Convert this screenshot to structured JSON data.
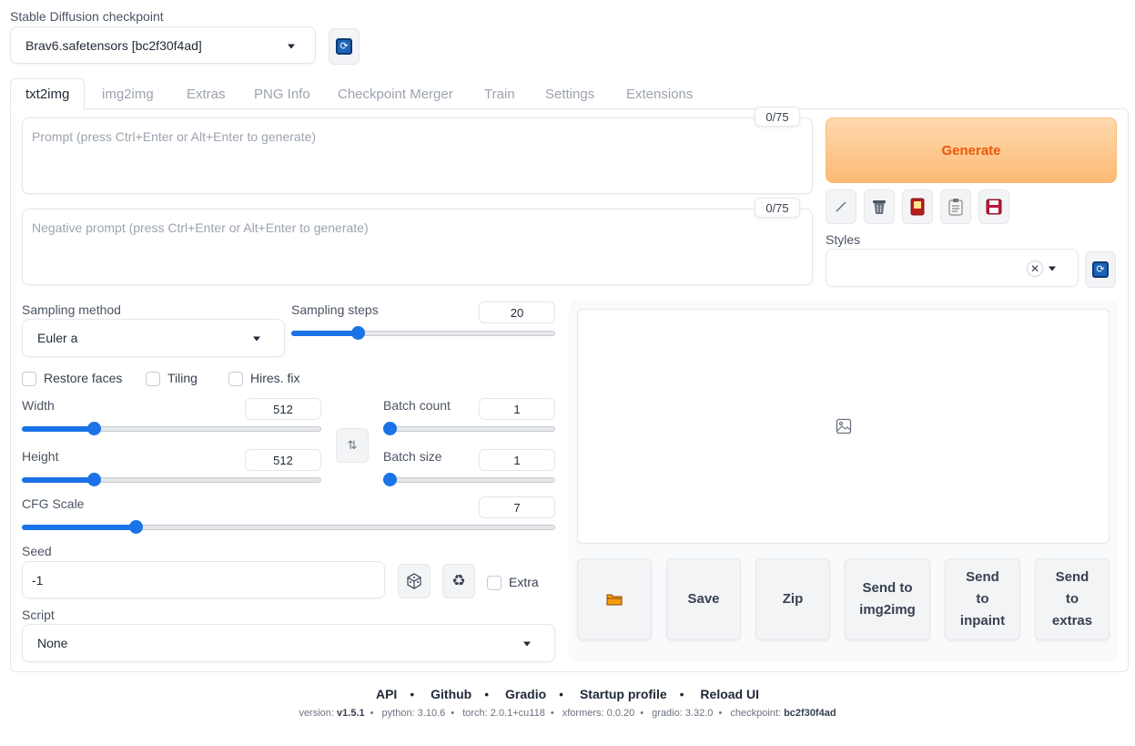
{
  "checkpoint": {
    "label": "Stable Diffusion checkpoint",
    "value": "Brav6.safetensors [bc2f30f4ad]"
  },
  "tabs": [
    {
      "label": "txt2img"
    },
    {
      "label": "img2img"
    },
    {
      "label": "Extras"
    },
    {
      "label": "PNG Info"
    },
    {
      "label": "Checkpoint Merger"
    },
    {
      "label": "Train"
    },
    {
      "label": "Settings"
    },
    {
      "label": "Extensions"
    }
  ],
  "prompt": {
    "placeholder": "Prompt (press Ctrl+Enter or Alt+Enter to generate)",
    "counter": "0/75"
  },
  "negative_prompt": {
    "placeholder": "Negative prompt (press Ctrl+Enter or Alt+Enter to generate)",
    "counter": "0/75"
  },
  "generate_label": "Generate",
  "styles_label": "Styles",
  "sampling": {
    "method_label": "Sampling method",
    "method_value": "Euler a",
    "steps_label": "Sampling steps",
    "steps_value": "20",
    "steps_fraction": 0.25
  },
  "checkboxes": {
    "restore_faces": "Restore faces",
    "tiling": "Tiling",
    "hires_fix": "Hires. fix"
  },
  "width": {
    "label": "Width",
    "value": "512",
    "fraction": 0.24
  },
  "height": {
    "label": "Height",
    "value": "512",
    "fraction": 0.24
  },
  "batch_count": {
    "label": "Batch count",
    "value": "1",
    "fraction": 0.0
  },
  "batch_size": {
    "label": "Batch size",
    "value": "1",
    "fraction": 0.0
  },
  "cfg_scale": {
    "label": "CFG Scale",
    "value": "7",
    "fraction": 0.214
  },
  "seed": {
    "label": "Seed",
    "value": "-1",
    "extra_label": "Extra"
  },
  "script": {
    "label": "Script",
    "value": "None"
  },
  "output_buttons": {
    "save": "Save",
    "zip": "Zip",
    "send_img2img": "Send to img2img",
    "send_inpaint": "Send to inpaint",
    "send_extras": "Send to extras"
  },
  "footer": {
    "links": [
      "API",
      "Github",
      "Gradio",
      "Startup profile",
      "Reload UI"
    ],
    "version_label": "version:",
    "version": "v1.5.1",
    "python": "python: 3.10.6",
    "torch": "torch: 2.0.1+cu118",
    "xformers": "xformers: 0.0.20",
    "gradio": "gradio: 3.32.0",
    "checkpoint_label": "checkpoint:",
    "checkpoint": "bc2f30f4ad"
  },
  "icons": {
    "refresh": "refresh-icon",
    "pencil": "pencil-icon",
    "trash": "trash-icon",
    "card": "extra-networks-icon",
    "clipboard": "clipboard-icon",
    "save": "floppy-icon",
    "dice": "dice-icon",
    "recycle": "recycle-icon",
    "folder": "folder-icon",
    "image": "image-placeholder-icon"
  }
}
